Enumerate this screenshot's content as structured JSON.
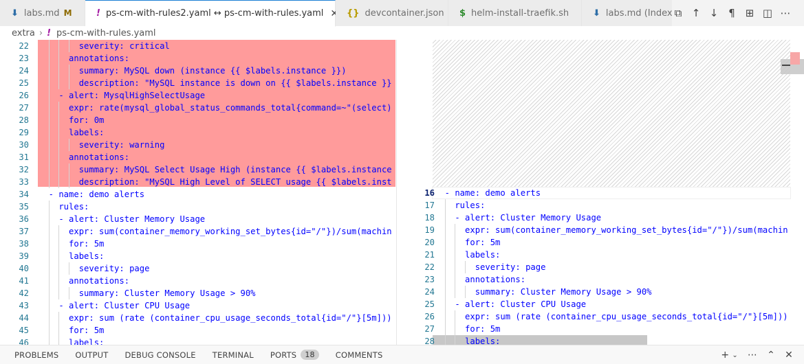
{
  "tabs": [
    {
      "label": "labs.md",
      "icon": "markdown-icon",
      "modified": "M",
      "active": false
    },
    {
      "label": "ps-cm-with-rules2.yaml ↔ ps-cm-with-rules.yaml",
      "icon": "yaml-icon",
      "active": true
    },
    {
      "label": "devcontainer.json",
      "icon": "json-icon",
      "active": false
    },
    {
      "label": "helm-install-traefik.sh",
      "icon": "shell-icon",
      "active": false
    },
    {
      "label": "labs.md (Index)",
      "icon": "markdown-icon",
      "active": false
    }
  ],
  "breadcrumb": {
    "folder": "extra",
    "file": "ps-cm-with-rules.yaml"
  },
  "left_lines": [
    {
      "n": "22",
      "text": "        severity: critical"
    },
    {
      "n": "23",
      "text": "      annotations:"
    },
    {
      "n": "24",
      "text": "        summary: MySQL down (instance {{ $labels.instance }})"
    },
    {
      "n": "25",
      "text": "        description: \"MySQL instance is down on {{ $labels.instance }}"
    },
    {
      "n": "26",
      "text": "    - alert: MysqlHighSelectUsage"
    },
    {
      "n": "27",
      "text": "      expr: rate(mysql_global_status_commands_total{command=~\"(select)"
    },
    {
      "n": "28",
      "text": "      for: 0m"
    },
    {
      "n": "29",
      "text": "      labels:"
    },
    {
      "n": "30",
      "text": "        severity: warning"
    },
    {
      "n": "31",
      "text": "      annotations:"
    },
    {
      "n": "32",
      "text": "        summary: MySQL Select Usage High (instance {{ $labels.instance"
    },
    {
      "n": "33",
      "text": "        description: \"MySQL High Level of SELECT usage {{ $labels.inst"
    },
    {
      "n": "34",
      "text": "  - name: demo alerts"
    },
    {
      "n": "35",
      "text": "    rules:"
    },
    {
      "n": "36",
      "text": "    - alert: Cluster Memory Usage"
    },
    {
      "n": "37",
      "text": "      expr: sum(container_memory_working_set_bytes{id=\"/\"})/sum(machin"
    },
    {
      "n": "38",
      "text": "      for: 5m"
    },
    {
      "n": "39",
      "text": "      labels:"
    },
    {
      "n": "40",
      "text": "        severity: page"
    },
    {
      "n": "41",
      "text": "      annotations:"
    },
    {
      "n": "42",
      "text": "        summary: Cluster Memory Usage > 90%"
    },
    {
      "n": "43",
      "text": "    - alert: Cluster CPU Usage"
    },
    {
      "n": "44",
      "text": "      expr: sum (rate (container_cpu_usage_seconds_total{id=\"/\"}[5m]))"
    },
    {
      "n": "45",
      "text": "      for: 5m"
    },
    {
      "n": "46",
      "text": "      labels:"
    }
  ],
  "right_lines": [
    {
      "n": "16",
      "text": "  - name: demo alerts"
    },
    {
      "n": "17",
      "text": "    rules:"
    },
    {
      "n": "18",
      "text": "    - alert: Cluster Memory Usage"
    },
    {
      "n": "19",
      "text": "      expr: sum(container_memory_working_set_bytes{id=\"/\"})/sum(machin"
    },
    {
      "n": "20",
      "text": "      for: 5m"
    },
    {
      "n": "21",
      "text": "      labels:"
    },
    {
      "n": "22",
      "text": "        severity: page"
    },
    {
      "n": "23",
      "text": "      annotations:"
    },
    {
      "n": "24",
      "text": "        summary: Cluster Memory Usage > 90%"
    },
    {
      "n": "25",
      "text": "    - alert: Cluster CPU Usage"
    },
    {
      "n": "26",
      "text": "      expr: sum (rate (container_cpu_usage_seconds_total{id=\"/\"}[5m]))"
    },
    {
      "n": "27",
      "text": "      for: 5m"
    },
    {
      "n": "28",
      "text": "      labels:"
    }
  ],
  "panel_tabs": [
    {
      "label": "PROBLEMS"
    },
    {
      "label": "OUTPUT"
    },
    {
      "label": "DEBUG CONSOLE"
    },
    {
      "label": "TERMINAL"
    },
    {
      "label": "PORTS",
      "badge": "18"
    },
    {
      "label": "COMMENTS"
    }
  ],
  "colors": {
    "removed": "#ff9b9b",
    "code": "#0000ff",
    "line_number": "#237893"
  }
}
